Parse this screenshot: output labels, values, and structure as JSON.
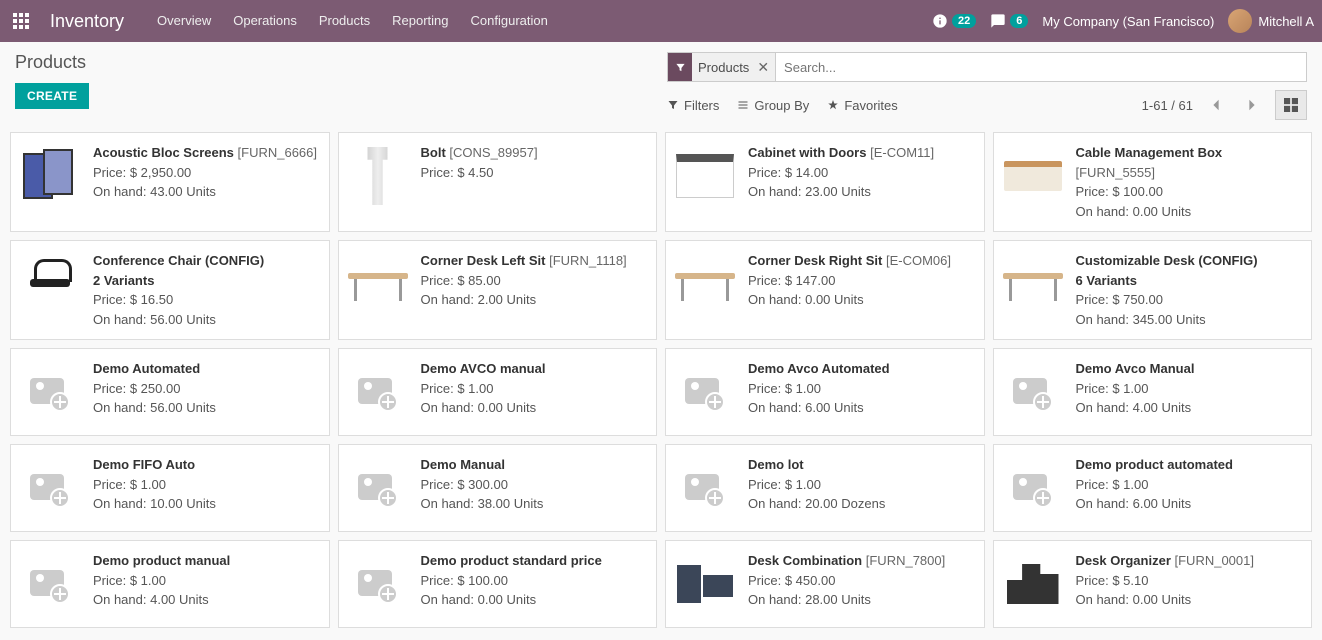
{
  "header": {
    "app_title": "Inventory",
    "menus": [
      "Overview",
      "Operations",
      "Products",
      "Reporting",
      "Configuration"
    ],
    "activity_count": "22",
    "chat_count": "6",
    "company": "My Company (San Francisco)",
    "user": "Mitchell A"
  },
  "controls": {
    "page_title": "Products",
    "create_label": "CREATE",
    "search_facet": "Products",
    "search_placeholder": "Search...",
    "filters_label": "Filters",
    "groupby_label": "Group By",
    "favorites_label": "Favorites",
    "pager_text": "1-61 / 61"
  },
  "products": [
    {
      "name": "Acoustic Bloc Screens",
      "code": "[FURN_6666]",
      "variants": "",
      "price": "Price: $ 2,950.00",
      "onhand": "On hand: 43.00 Units",
      "thumb": "screen"
    },
    {
      "name": "Bolt",
      "code": "[CONS_89957]",
      "variants": "",
      "price": "Price: $ 4.50",
      "onhand": "",
      "thumb": "bolt"
    },
    {
      "name": "Cabinet with Doors",
      "code": "[E-COM11]",
      "variants": "",
      "price": "Price: $ 14.00",
      "onhand": "On hand: 23.00 Units",
      "thumb": "cabinet"
    },
    {
      "name": "Cable Management Box",
      "code": "[FURN_5555]",
      "variants": "",
      "price": "Price: $ 100.00",
      "onhand": "On hand: 0.00 Units",
      "thumb": "cablebox"
    },
    {
      "name": "Conference Chair (CONFIG)",
      "code": "",
      "variants": "2 Variants",
      "price": "Price: $ 16.50",
      "onhand": "On hand: 56.00 Units",
      "thumb": "chair"
    },
    {
      "name": "Corner Desk Left Sit",
      "code": "[FURN_1118]",
      "variants": "",
      "price": "Price: $ 85.00",
      "onhand": "On hand: 2.00 Units",
      "thumb": "desk"
    },
    {
      "name": "Corner Desk Right Sit",
      "code": "[E-COM06]",
      "variants": "",
      "price": "Price: $ 147.00",
      "onhand": "On hand: 0.00 Units",
      "thumb": "desk"
    },
    {
      "name": "Customizable Desk (CONFIG)",
      "code": "",
      "variants": "6 Variants",
      "price": "Price: $ 750.00",
      "onhand": "On hand: 345.00 Units",
      "thumb": "desk"
    },
    {
      "name": "Demo Automated",
      "code": "",
      "variants": "",
      "price": "Price: $ 250.00",
      "onhand": "On hand: 56.00 Units",
      "thumb": "placeholder"
    },
    {
      "name": "Demo AVCO manual",
      "code": "",
      "variants": "",
      "price": "Price: $ 1.00",
      "onhand": "On hand: 0.00 Units",
      "thumb": "placeholder"
    },
    {
      "name": "Demo Avco Automated",
      "code": "",
      "variants": "",
      "price": "Price: $ 1.00",
      "onhand": "On hand: 6.00 Units",
      "thumb": "placeholder"
    },
    {
      "name": "Demo Avco Manual",
      "code": "",
      "variants": "",
      "price": "Price: $ 1.00",
      "onhand": "On hand: 4.00 Units",
      "thumb": "placeholder"
    },
    {
      "name": "Demo FIFO Auto",
      "code": "",
      "variants": "",
      "price": "Price: $ 1.00",
      "onhand": "On hand: 10.00 Units",
      "thumb": "placeholder"
    },
    {
      "name": "Demo Manual",
      "code": "",
      "variants": "",
      "price": "Price: $ 300.00",
      "onhand": "On hand: 38.00 Units",
      "thumb": "placeholder"
    },
    {
      "name": "Demo lot",
      "code": "",
      "variants": "",
      "price": "Price: $ 1.00",
      "onhand": "On hand: 20.00 Dozens",
      "thumb": "placeholder"
    },
    {
      "name": "Demo product automated",
      "code": "",
      "variants": "",
      "price": "Price: $ 1.00",
      "onhand": "On hand: 6.00 Units",
      "thumb": "placeholder"
    },
    {
      "name": "Demo product manual",
      "code": "",
      "variants": "",
      "price": "Price: $ 1.00",
      "onhand": "On hand: 4.00 Units",
      "thumb": "placeholder"
    },
    {
      "name": "Demo product standard price",
      "code": "",
      "variants": "",
      "price": "Price: $ 100.00",
      "onhand": "On hand: 0.00 Units",
      "thumb": "placeholder"
    },
    {
      "name": "Desk Combination",
      "code": "[FURN_7800]",
      "variants": "",
      "price": "Price: $ 450.00",
      "onhand": "On hand: 28.00 Units",
      "thumb": "deskcombo"
    },
    {
      "name": "Desk Organizer",
      "code": "[FURN_0001]",
      "variants": "",
      "price": "Price: $ 5.10",
      "onhand": "On hand: 0.00 Units",
      "thumb": "organizer"
    }
  ]
}
